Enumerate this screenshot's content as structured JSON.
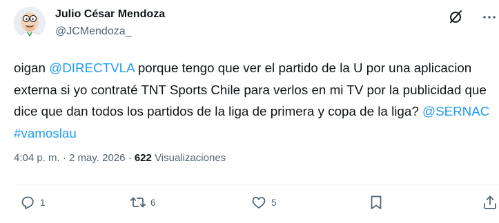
{
  "author": {
    "name": "Julio César Mendoza",
    "handle": "@JCMendoza_"
  },
  "tweet": {
    "segments": [
      {
        "text": "oigan ",
        "type": "text"
      },
      {
        "text": "@DIRECTVLA",
        "type": "link"
      },
      {
        "text": " porque tengo que ver el partido de la U por una aplicacion externa si yo contraté TNT Sports Chile para verlos en mi TV por la publicidad que dice que dan todos los partidos de la liga de primera y copa de la liga? ",
        "type": "text"
      },
      {
        "text": "@SERNAC",
        "type": "link"
      },
      {
        "text": " ",
        "type": "text"
      },
      {
        "text": "#vamoslau",
        "type": "link"
      }
    ]
  },
  "meta": {
    "time": "4:04 p. m.",
    "separator": "·",
    "date": "2 may. 2026",
    "views_count": "622",
    "views_label": "Visualizaciones"
  },
  "actions": {
    "replies": "1",
    "retweets": "6",
    "likes": "5"
  },
  "icons": {
    "header_right": [
      "grok-icon",
      "more-icon"
    ],
    "action_bar": [
      "reply-icon",
      "retweet-icon",
      "like-icon",
      "bookmark-icon",
      "share-icon"
    ]
  },
  "colors": {
    "link": "#1d9bf0",
    "text": "#0f1419",
    "secondary": "#536471",
    "divider": "#eff3f4"
  }
}
